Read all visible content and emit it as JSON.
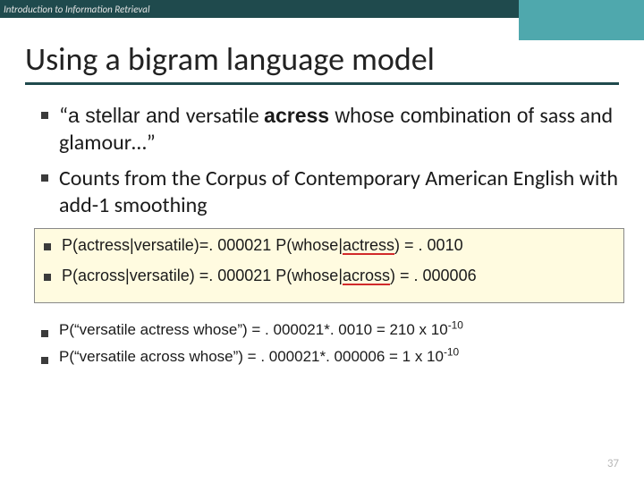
{
  "header": {
    "label": "Introduction to Information Retrieval"
  },
  "title": "Using a bigram language model",
  "bullets": {
    "quote": {
      "openq": "“",
      "t1": "a stellar and ",
      "t2": "versatile ",
      "bold": "acress",
      "t3": " whose combination of ",
      "t4": "sass and glamour…",
      "closeq": "”"
    },
    "corpus": "Counts from the Corpus of Contemporary American English with add-1 smoothing",
    "p1": {
      "a": "P(actress|versatile)=. 000021 P(whose|",
      "u": "actress",
      "b": ") = . 0010"
    },
    "p2": {
      "a": "P(across|versatile) =. 000021 P(whose|",
      "u": "across",
      "b": ") = . 000006"
    },
    "p3": {
      "a": "P(“versatile actress whose”) = . 000021*. 0010 = 210 x 10",
      "exp": "-10"
    },
    "p4": {
      "a": "P(“versatile across whose”)  = . 000021*. 000006 = 1 x 10",
      "exp": "-10"
    }
  },
  "page": "37"
}
